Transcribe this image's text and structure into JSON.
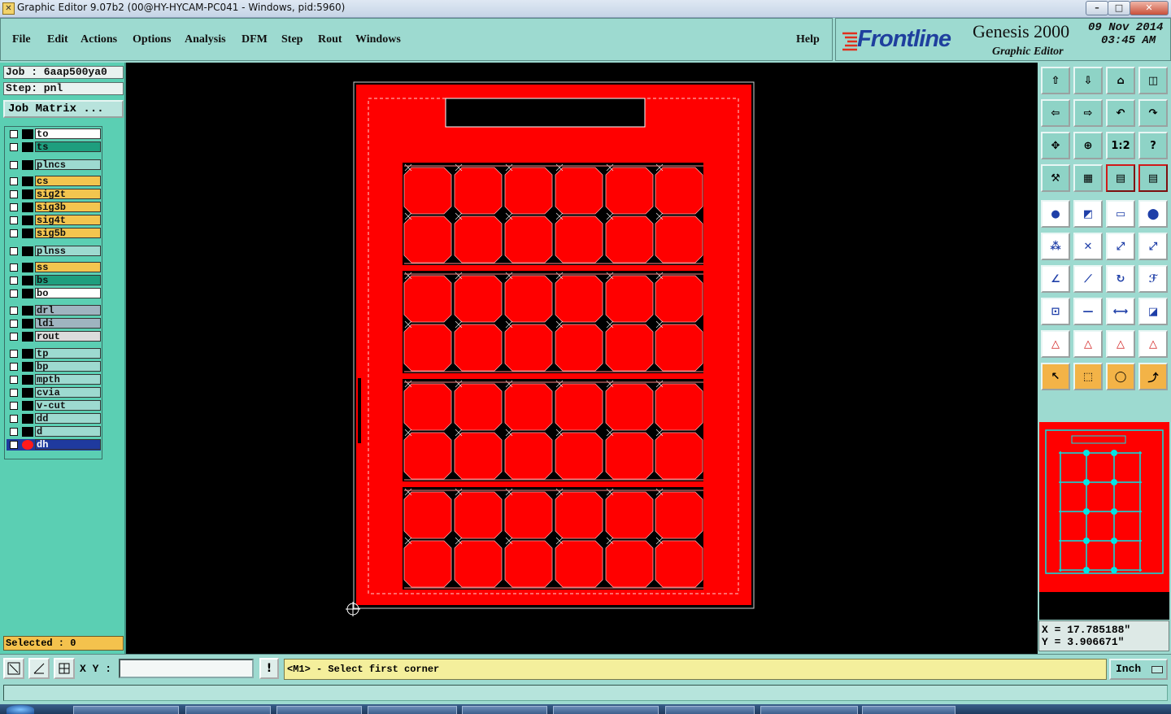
{
  "titlebar": {
    "title": "Graphic Editor 9.07b2 (00@HY-HYCAM-PC041 - Windows, pid:5960)",
    "app_icon": "genesis-app-icon"
  },
  "menu": {
    "items": [
      "File",
      "Edit",
      "Actions",
      "Options",
      "Analysis",
      "DFM",
      "Step",
      "Rout",
      "Windows"
    ],
    "help": "Help"
  },
  "logo": {
    "brand": "Frontline",
    "product": "Genesis 2000",
    "subtitle": "Graphic Editor",
    "date": "09 Nov 2014",
    "time": "03:45 AM"
  },
  "job": {
    "job_label": "Job : 6aap500ya0",
    "step_label": "Step: pnl",
    "matrix_button": "Job Matrix ..."
  },
  "layers": [
    {
      "name": "to",
      "color": "#ffffff"
    },
    {
      "name": "ts",
      "color": "#1e9e7e"
    },
    {
      "name": "plncs",
      "color": "#9ddad0"
    },
    {
      "name": "cs",
      "color": "#f3c54f"
    },
    {
      "name": "sig2t",
      "color": "#f3c54f"
    },
    {
      "name": "sig3b",
      "color": "#f3c54f"
    },
    {
      "name": "sig4t",
      "color": "#f3c54f"
    },
    {
      "name": "sig5b",
      "color": "#f3c54f"
    },
    {
      "name": "plnss",
      "color": "#9ddad0"
    },
    {
      "name": "ss",
      "color": "#f3c54f"
    },
    {
      "name": "bs",
      "color": "#1e9e7e"
    },
    {
      "name": "bo",
      "color": "#ffffff"
    },
    {
      "name": "drl",
      "color": "#9fb4c0"
    },
    {
      "name": "ldi",
      "color": "#9fb4c0"
    },
    {
      "name": "rout",
      "color": "#dcdcdc"
    },
    {
      "name": "tp",
      "color": "#9ddad0"
    },
    {
      "name": "bp",
      "color": "#9ddad0"
    },
    {
      "name": "mpth",
      "color": "#9ddad0"
    },
    {
      "name": "cvia",
      "color": "#9ddad0"
    },
    {
      "name": "v-cut",
      "color": "#9ddad0"
    },
    {
      "name": "dd",
      "color": "#9ddad0"
    },
    {
      "name": "d",
      "color": "#9ddad0"
    },
    {
      "name": "dh",
      "color": "#9ddad0"
    }
  ],
  "selected": "Selected : 0",
  "coords": {
    "x": "X = 17.785188\"",
    "y": "Y = 3.906671\""
  },
  "command": {
    "xy_label": "X Y :",
    "xy_value": "",
    "prompt": "<M1> - Select first corner",
    "unit": "Inch"
  },
  "colors": {
    "panel_teal": "#9ddad0",
    "layer_panel": "#5bcfb3",
    "board_red": "#ff0000",
    "outline_cyan": "#00e5e5",
    "canvas": "#000000",
    "highlight_orange": "#f3b347"
  },
  "toolbar_icons": [
    [
      "zoom-home-icon",
      "pan-down-icon",
      "home-view-icon",
      "window-split-icon"
    ],
    [
      "pan-left-icon",
      "pan-right-icon",
      "undo-zoom-icon",
      "redo-zoom-icon"
    ],
    [
      "zoom-fit-icon",
      "zoom-profile-icon",
      "zoom-1-2-icon",
      "help-icon"
    ],
    [
      "measure-tool-icon",
      "grid-icon",
      "layers-red-icon",
      "layers-red-2-icon"
    ],
    [
      "pad-icon",
      "line-icon",
      "ruler-icon",
      "circle-pad-icon"
    ],
    [
      "node-icon",
      "cross-icon",
      "connect-icon",
      "connect-2-icon"
    ],
    [
      "angle-icon",
      "slash-icon",
      "arc-icon",
      "text-ff-icon"
    ],
    [
      "snap-icon",
      "horizontal-line-icon",
      "dimension-icon",
      "shape-icon"
    ],
    [
      "triangle-icon",
      "triangle-2-icon",
      "triangle-3-icon",
      "triangle-4-icon"
    ],
    [
      "select-arrow-icon",
      "select-box-icon",
      "select-circle-icon",
      "select-path-icon"
    ]
  ]
}
